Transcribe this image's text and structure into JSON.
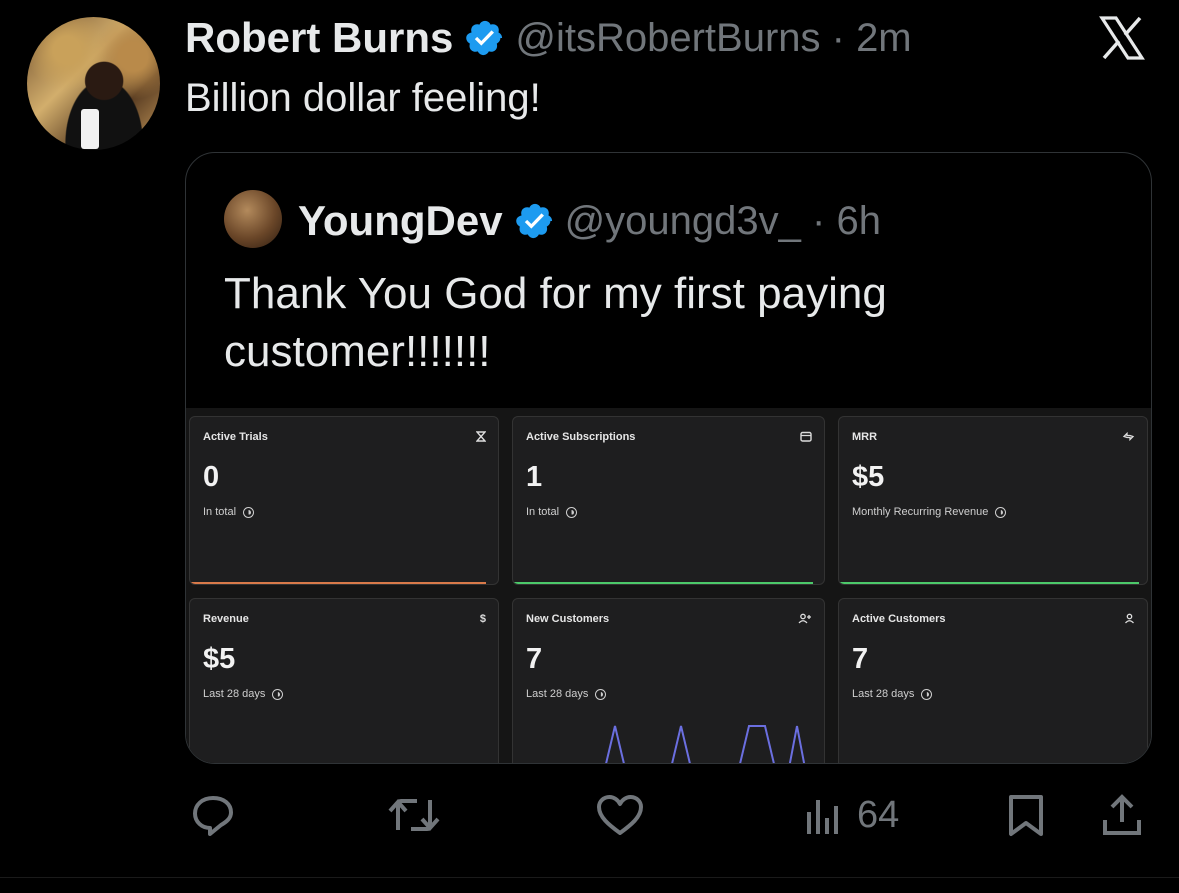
{
  "tweet": {
    "author_name": "Robert Burns",
    "author_handle": "@itsRobertBurns",
    "time": "2m",
    "text": "Billion dollar feeling!"
  },
  "quoted_tweet": {
    "author_name": "YoungDev",
    "author_handle": "@youngd3v_",
    "time": "6h",
    "text": "Thank You God for my first paying customer!!!!!!!"
  },
  "dashboard": {
    "cards": [
      {
        "title": "Active Trials",
        "icon": "hourglass-icon",
        "value": "0",
        "sub": "In total",
        "accent": "#d97a4a"
      },
      {
        "title": "Active Subscriptions",
        "icon": "calendar-icon",
        "value": "1",
        "sub": "In total",
        "accent": "#4cc96a"
      },
      {
        "title": "MRR",
        "icon": "repeat-icon",
        "value": "$5",
        "sub": "Monthly Recurring Revenue",
        "accent": "#4cc96a"
      },
      {
        "title": "Revenue",
        "icon": "dollar-icon",
        "value": "$5",
        "sub": "Last 28 days",
        "accent": "#6fb56f"
      },
      {
        "title": "New Customers",
        "icon": "user-plus-icon",
        "value": "7",
        "sub": "Last 28 days",
        "accent": "#6b6fe0"
      },
      {
        "title": "Active Customers",
        "icon": "user-icon",
        "value": "7",
        "sub": "Last 28 days",
        "accent": "#6b6fe0"
      }
    ]
  },
  "actions": {
    "reply": "reply-icon",
    "retweet": "retweet-icon",
    "like": "heart-icon",
    "views_count": "64",
    "bookmark": "bookmark-icon",
    "share": "share-icon"
  },
  "colors": {
    "background": "#000000",
    "verified_blue": "#1d9bf0",
    "muted_text": "#71767b",
    "text": "#e7e9ea"
  }
}
